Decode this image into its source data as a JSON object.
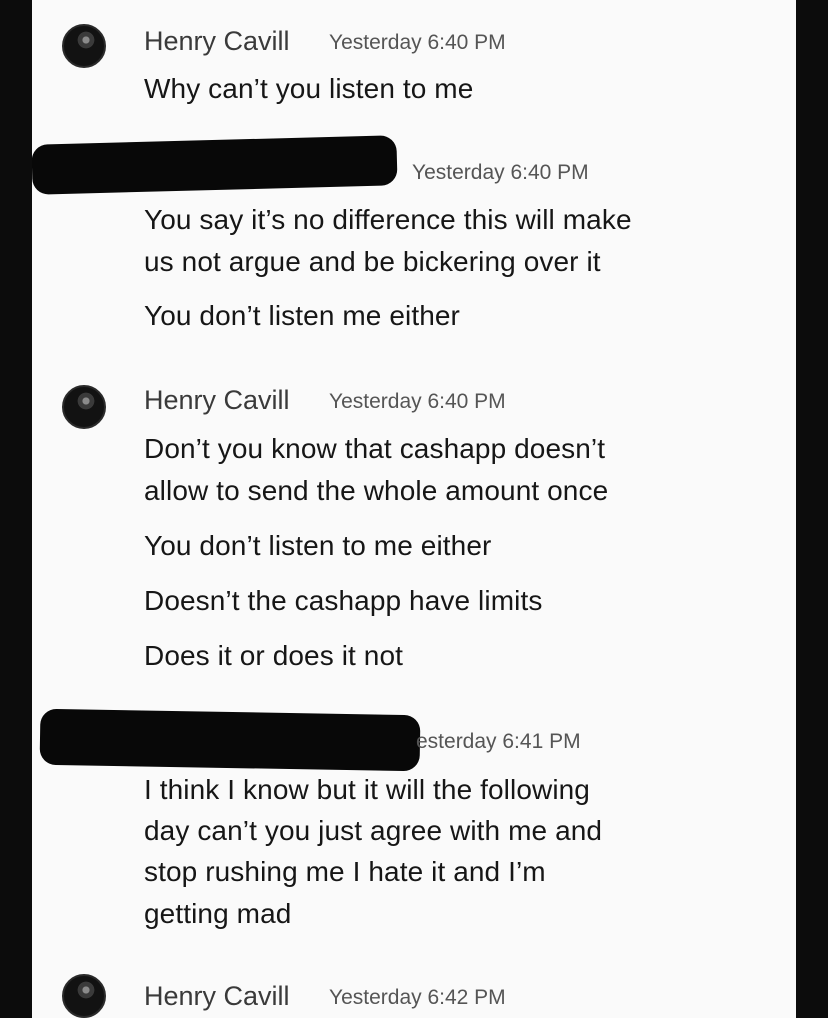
{
  "conversation": [
    {
      "sender": "Henry Cavill",
      "timestamp": "Yesterday 6:40 PM",
      "lines": [
        "Why can’t you listen to me"
      ]
    },
    {
      "sender": "",
      "timestamp": "Yesterday 6:40 PM",
      "lines": [
        "You say it’s no difference this will make",
        "us not argue and be bickering over it",
        "You don’t listen me either"
      ]
    },
    {
      "sender": "Henry Cavill",
      "timestamp": "Yesterday 6:40 PM",
      "lines": [
        "Don’t you know that cashapp doesn’t",
        "allow to send the whole amount once",
        "You don’t listen to me either",
        "Doesn’t the cashapp have limits",
        "Does it or does it not"
      ]
    },
    {
      "sender": "",
      "timestamp": "esterday 6:41 PM",
      "lines": [
        "I think I know but it will the following",
        "day can’t you just agree with me and",
        "stop rushing me I hate it and I’m",
        "getting mad"
      ]
    },
    {
      "sender": "Henry Cavill",
      "timestamp": "Yesterday 6:42 PM",
      "lines": []
    }
  ]
}
